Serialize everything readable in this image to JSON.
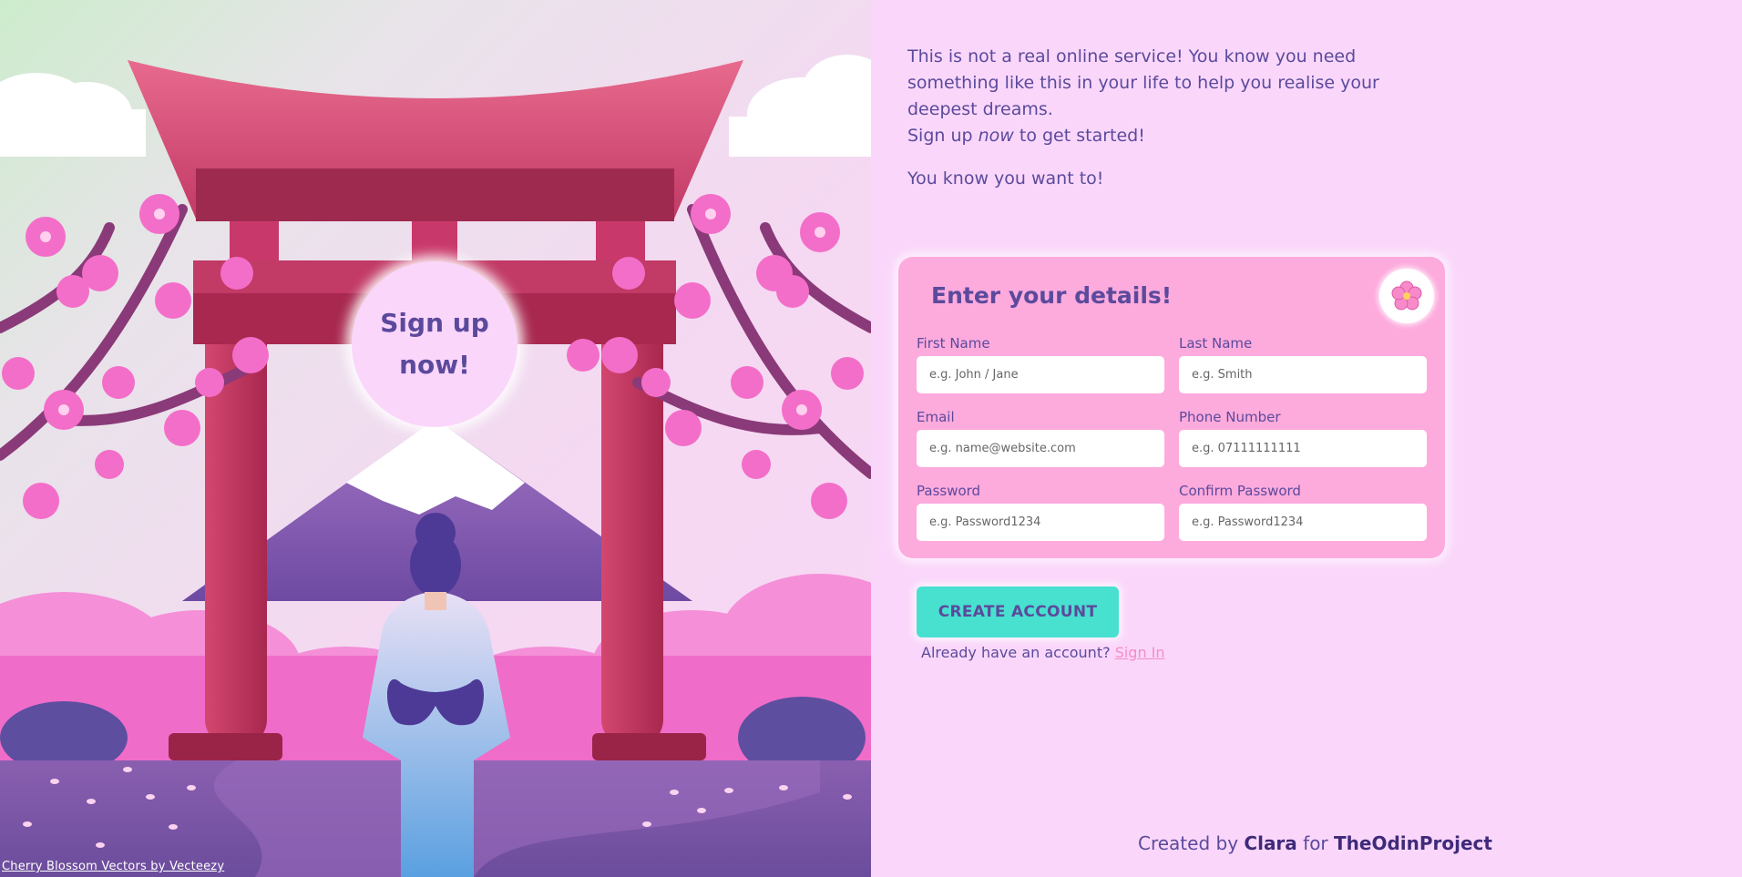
{
  "hero": {
    "cta_text": "Sign up now!",
    "credit_link": "Cherry Blossom Vectors by Vecteezy"
  },
  "intro": {
    "line1": "This is not a real online service! You know you need something like this in your life to help you realise your deepest dreams.",
    "line2_before": "Sign up ",
    "line2_em": "now",
    "line2_after": " to get started!",
    "line3": "You know you want to!"
  },
  "form": {
    "title": "Enter your details!",
    "badge_icon": "cherry-blossom-icon",
    "fields": {
      "first_name": {
        "label": "First Name",
        "placeholder": "e.g. John / Jane"
      },
      "last_name": {
        "label": "Last Name",
        "placeholder": "e.g. Smith"
      },
      "email": {
        "label": "Email",
        "placeholder": "e.g. name@website.com"
      },
      "phone": {
        "label": "Phone Number",
        "placeholder": "e.g. 07111111111"
      },
      "password": {
        "label": "Password",
        "placeholder": "e.g. Password1234"
      },
      "confirm_password": {
        "label": "Confirm Password",
        "placeholder": "e.g. Password1234"
      }
    },
    "submit_label": "CREATE ACCOUNT",
    "signin_prompt": "Already have an account?",
    "signin_link": "Sign In"
  },
  "footer": {
    "created_by": "Created by",
    "author": "Clara",
    "for": "for",
    "org": "TheOdinProject"
  },
  "colors": {
    "page_bg": "#fad7fa",
    "card_bg": "#fdaadd",
    "text": "#5b4a9c",
    "button": "#48e0cf",
    "link": "#f58cc6"
  }
}
